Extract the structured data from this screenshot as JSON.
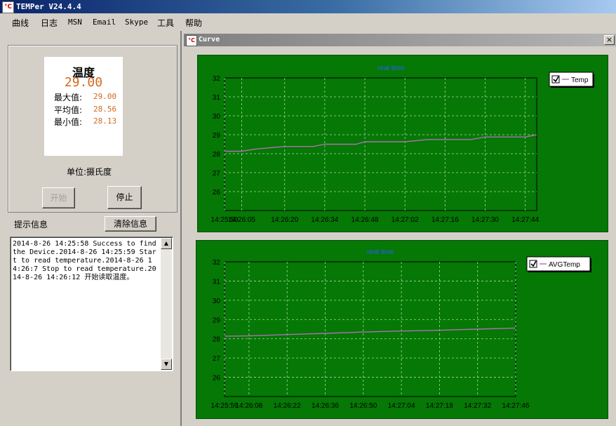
{
  "window": {
    "title": "TEMPer V24.4.4"
  },
  "menu": [
    "曲线",
    "日志",
    "MSN",
    "Email",
    "Skype",
    "工具",
    "帮助"
  ],
  "reading": {
    "heading": "温度",
    "current": "29.00",
    "max_label": "最大值:",
    "max_value": "29.00",
    "avg_label": "平均值:",
    "avg_value": "28.56",
    "min_label": "最小值:",
    "min_value": "28.13",
    "unit": "单位:摄氏度"
  },
  "buttons": {
    "start": "开始",
    "stop": "停止",
    "clear": "清除信息"
  },
  "log": {
    "label": "提示信息",
    "text": "2014-8-26 14:25:58 Success to find the Device.2014-8-26 14:25:59 Start to read temperature.2014-8-26 14:26:7 Stop to read temperature.2014-8-26 14:26:12 开始读取温度。"
  },
  "curve_window": {
    "title": "Curve",
    "close_glyph": "×"
  },
  "colors": {
    "plot_bg": "#057805",
    "line": "#b06fb0",
    "grid": "#a8d8a8",
    "title": "#2a5cff"
  },
  "chart_data": [
    {
      "type": "line",
      "title": "real time",
      "x": [
        "14:25:59",
        "14:26:05",
        "14:26:10",
        "14:26:20",
        "14:26:30",
        "14:26:34",
        "14:26:45",
        "14:26:48",
        "14:26:55",
        "14:27:02",
        "14:27:10",
        "14:27:18",
        "14:27:25",
        "14:27:30",
        "14:27:40",
        "14:27:44",
        "14:27:48"
      ],
      "xticks": [
        "14:25:59",
        "14:26:05",
        "14:26:20",
        "14:26:34",
        "14:26:48",
        "14:27:02",
        "14:27:16",
        "14:27:30",
        "14:27:44"
      ],
      "series": [
        {
          "name": "Temp",
          "values": [
            28.13,
            28.13,
            28.25,
            28.38,
            28.38,
            28.5,
            28.5,
            28.63,
            28.63,
            28.63,
            28.75,
            28.75,
            28.75,
            28.88,
            28.88,
            28.88,
            29.0
          ]
        }
      ],
      "ylim": [
        25,
        32
      ],
      "yticks": [
        26,
        27,
        28,
        29,
        30,
        31,
        32
      ],
      "grid": true,
      "legend": "top-right"
    },
    {
      "type": "line",
      "title": "real time",
      "x": [
        "14:25:59",
        "14:26:08",
        "14:26:22",
        "14:26:36",
        "14:26:50",
        "14:27:04",
        "14:27:18",
        "14:27:32",
        "14:27:46"
      ],
      "xticks": [
        "14:25:59",
        "14:26:08",
        "14:26:22",
        "14:26:36",
        "14:26:50",
        "14:27:04",
        "14:27:18",
        "14:27:32",
        "14:27:46"
      ],
      "series": [
        {
          "name": "AVGTemp",
          "values": [
            28.13,
            28.15,
            28.22,
            28.28,
            28.35,
            28.4,
            28.44,
            28.5,
            28.56
          ]
        }
      ],
      "ylim": [
        25,
        32
      ],
      "yticks": [
        26,
        27,
        28,
        29,
        30,
        31,
        32
      ],
      "grid": true,
      "legend": "top-right"
    }
  ]
}
